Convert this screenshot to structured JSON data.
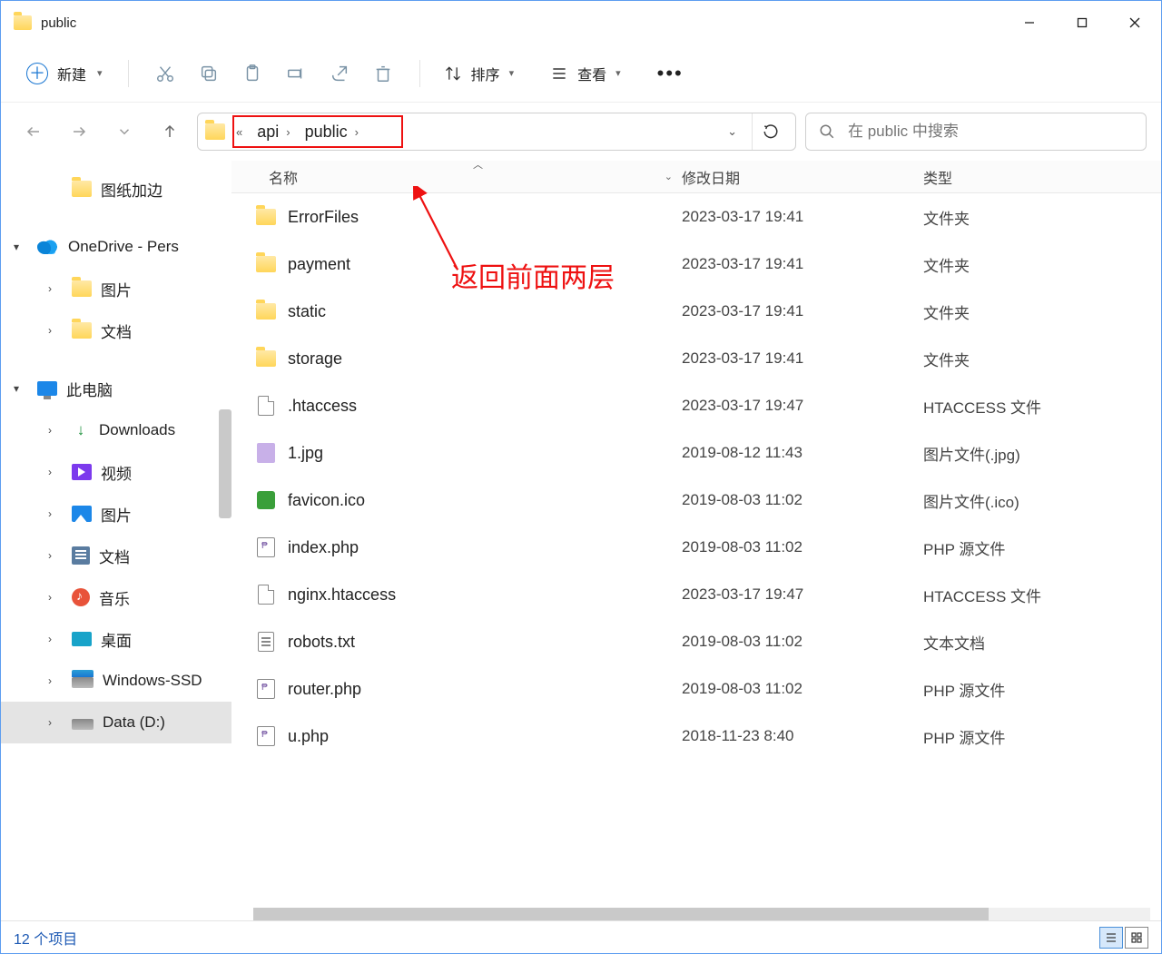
{
  "window": {
    "title": "public"
  },
  "toolbar": {
    "new_label": "新建",
    "sort_label": "排序",
    "view_label": "查看"
  },
  "breadcrumb": {
    "segments": [
      "api",
      "public"
    ]
  },
  "search": {
    "placeholder": "在 public 中搜索"
  },
  "sidebar": {
    "items": [
      {
        "label": "图纸加边",
        "icon": "folder",
        "indent": 1,
        "caret": ""
      },
      {
        "label": "OneDrive - Pers",
        "icon": "onedrive",
        "indent": 0,
        "caret": "▾"
      },
      {
        "label": "图片",
        "icon": "folder",
        "indent": 2,
        "caret": "›"
      },
      {
        "label": "文档",
        "icon": "folder",
        "indent": 2,
        "caret": "›"
      },
      {
        "label": "此电脑",
        "icon": "pc",
        "indent": 0,
        "caret": "▾"
      },
      {
        "label": "Downloads",
        "icon": "down",
        "indent": 2,
        "caret": "›"
      },
      {
        "label": "视频",
        "icon": "vid",
        "indent": 2,
        "caret": "›"
      },
      {
        "label": "图片",
        "icon": "img",
        "indent": 2,
        "caret": "›"
      },
      {
        "label": "文档",
        "icon": "doc",
        "indent": 2,
        "caret": "›"
      },
      {
        "label": "音乐",
        "icon": "music",
        "indent": 2,
        "caret": "›"
      },
      {
        "label": "桌面",
        "icon": "desk",
        "indent": 2,
        "caret": "›"
      },
      {
        "label": "Windows-SSD",
        "icon": "drive-c",
        "indent": 2,
        "caret": "›"
      },
      {
        "label": "Data (D:)",
        "icon": "drive",
        "indent": 2,
        "caret": "›",
        "selected": true
      }
    ]
  },
  "columns": {
    "name": "名称",
    "date": "修改日期",
    "type": "类型"
  },
  "files": [
    {
      "name": "ErrorFiles",
      "date": "2023-03-17 19:41",
      "type": "文件夹",
      "icon": "folder"
    },
    {
      "name": "payment",
      "date": "2023-03-17 19:41",
      "type": "文件夹",
      "icon": "folder"
    },
    {
      "name": "static",
      "date": "2023-03-17 19:41",
      "type": "文件夹",
      "icon": "folder"
    },
    {
      "name": "storage",
      "date": "2023-03-17 19:41",
      "type": "文件夹",
      "icon": "folder"
    },
    {
      "name": ".htaccess",
      "date": "2023-03-17 19:47",
      "type": "HTACCESS 文件",
      "icon": "file"
    },
    {
      "name": "1.jpg",
      "date": "2019-08-12 11:43",
      "type": "图片文件(.jpg)",
      "icon": "jpg"
    },
    {
      "name": "favicon.ico",
      "date": "2019-08-03 11:02",
      "type": "图片文件(.ico)",
      "icon": "ico"
    },
    {
      "name": "index.php",
      "date": "2019-08-03 11:02",
      "type": "PHP 源文件",
      "icon": "php"
    },
    {
      "name": "nginx.htaccess",
      "date": "2023-03-17 19:47",
      "type": "HTACCESS 文件",
      "icon": "file"
    },
    {
      "name": "robots.txt",
      "date": "2019-08-03 11:02",
      "type": "文本文档",
      "icon": "txt"
    },
    {
      "name": "router.php",
      "date": "2019-08-03 11:02",
      "type": "PHP 源文件",
      "icon": "php"
    },
    {
      "name": "u.php",
      "date": "2018-11-23 8:40",
      "type": "PHP 源文件",
      "icon": "php"
    }
  ],
  "annotation": {
    "text": "返回前面两层"
  },
  "status": {
    "text": "12 个项目"
  }
}
